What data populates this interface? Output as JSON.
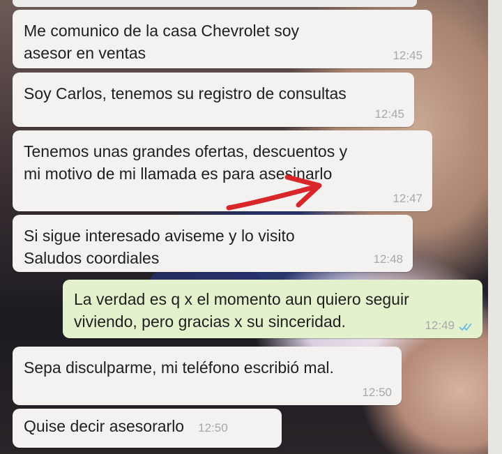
{
  "messages": [
    {
      "text": "Me comunico de la casa Chevrolet soy\nasesor en ventas",
      "time": "12:45",
      "from": "contact"
    },
    {
      "text": "Soy Carlos, tenemos su registro de consultas",
      "time": "12:45",
      "from": "contact"
    },
    {
      "text": "Tenemos unas grandes ofertas, descuentos y\nmi motivo de mi llamada es para asesinarlo",
      "time": "12:47",
      "from": "contact"
    },
    {
      "text": "Si sigue interesado aviseme y lo visito\nSaludos coordiales",
      "time": "12:48",
      "from": "contact"
    },
    {
      "text": "La verdad es q x el momento aun quiero seguir\nviviendo, pero gracias x su sinceridad.",
      "time": "12:49",
      "from": "me",
      "status": "read"
    },
    {
      "text": "Sepa disculparme, mi teléfono escribió mal.",
      "time": "12:50",
      "from": "contact"
    },
    {
      "text": "Quise decir asesorarlo",
      "time": "12:50",
      "from": "contact"
    }
  ],
  "colors": {
    "incoming_bubble": "#f4f2f0",
    "outgoing_bubble": "#e3f2cc",
    "read_ticks": "#6bb7e3",
    "annotation_arrow": "#d8262a"
  },
  "icons": {
    "read_receipt": "double-check-icon",
    "annotation": "red-arrow-icon"
  }
}
